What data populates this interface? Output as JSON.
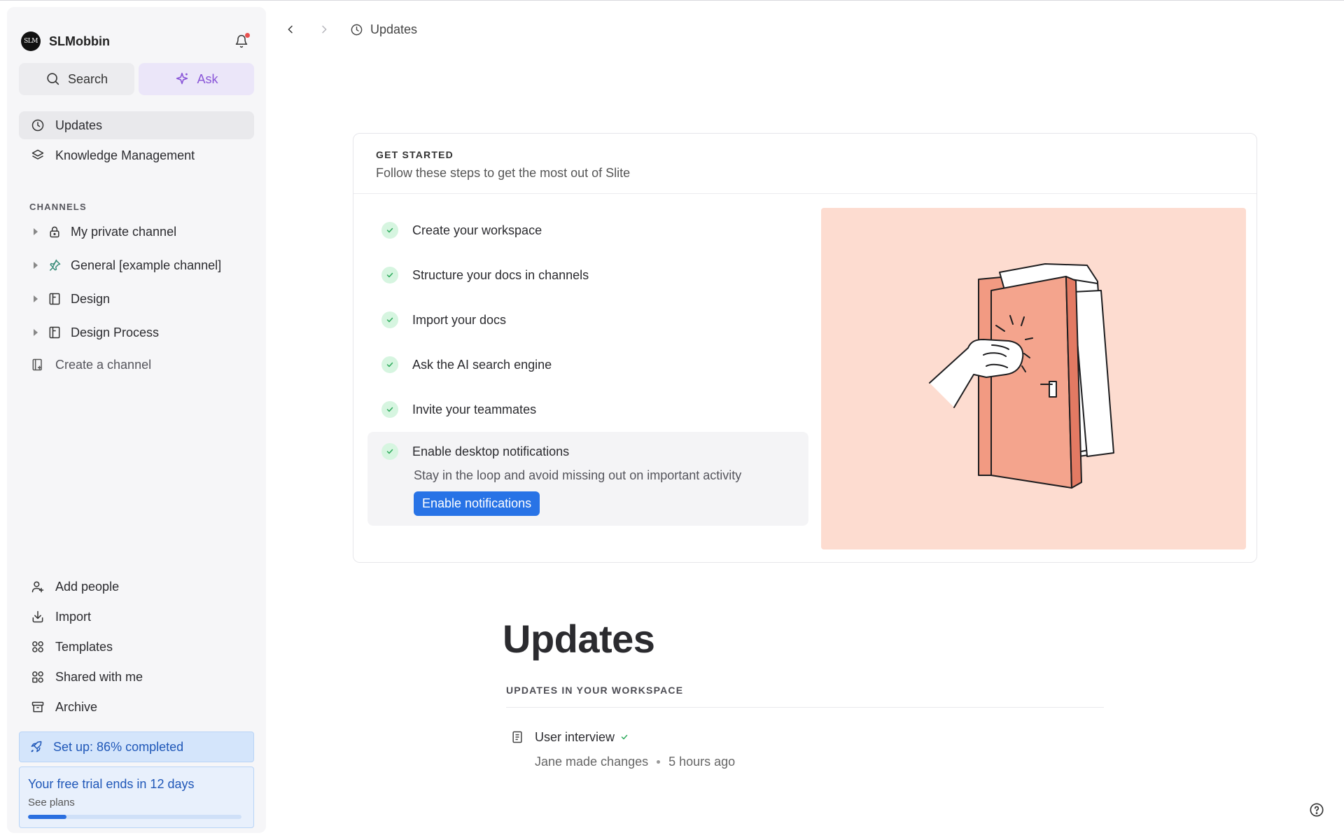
{
  "workspace": {
    "name": "SLMobbin",
    "logo_text": "SLM"
  },
  "search": {
    "label": "Search"
  },
  "ask": {
    "label": "Ask"
  },
  "nav": {
    "updates": "Updates",
    "knowledge": "Knowledge Management"
  },
  "channels": {
    "section_label": "CHANNELS",
    "items": [
      {
        "label": "My private channel",
        "icon": "lock-icon"
      },
      {
        "label": "General [example channel]",
        "icon": "pin-icon"
      },
      {
        "label": "Design",
        "icon": "layout-icon"
      },
      {
        "label": "Design Process",
        "icon": "layout-icon"
      }
    ],
    "create": "Create a channel"
  },
  "bottom_nav": {
    "add_people": "Add people",
    "import": "Import",
    "templates": "Templates",
    "shared": "Shared with me",
    "archive": "Archive"
  },
  "setup": {
    "label": "Set up: 86% completed",
    "percent": 86
  },
  "trial": {
    "title": "Your free trial ends in 12 days",
    "link": "See plans",
    "progress": 0.18
  },
  "breadcrumb": {
    "current": "Updates"
  },
  "get_started": {
    "kicker": "GET STARTED",
    "subtitle": "Follow these steps to get the most out of Slite",
    "steps": [
      "Create your workspace",
      "Structure your docs in channels",
      "Import your docs",
      "Ask the AI search engine",
      "Invite your teammates"
    ],
    "expanded": {
      "title": "Enable desktop notifications",
      "description": "Stay in the loop and avoid missing out on important activity",
      "button": "Enable notifications"
    }
  },
  "updates": {
    "title": "Updates",
    "section_label": "UPDATES IN YOUR WORKSPACE",
    "items": [
      {
        "title": "User interview",
        "author": "Jane made changes",
        "time": "5 hours ago"
      }
    ]
  },
  "colors": {
    "accent_blue": "#2873e6",
    "ask_purple": "#8a56d8",
    "illustration_bg": "#fddcd0",
    "check_green": "#2eaa5c"
  }
}
